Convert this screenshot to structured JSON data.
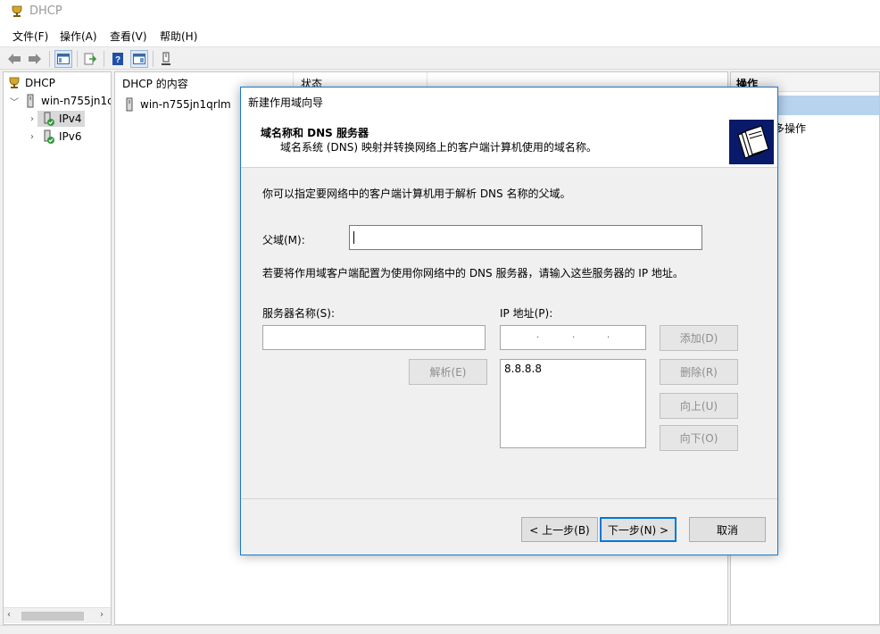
{
  "window": {
    "title": "DHCP"
  },
  "menu": [
    {
      "label": "文件(F)"
    },
    {
      "label": "操作(A)"
    },
    {
      "label": "查看(V)"
    },
    {
      "label": "帮助(H)"
    }
  ],
  "toolbar": {
    "buttons": [
      "back-arrow-icon",
      "forward-arrow-icon",
      "show-hide-console-tree-icon",
      "export-list-icon",
      "help-icon",
      "properties-icon",
      "server-icon"
    ]
  },
  "tree": {
    "root": "DHCP",
    "server": "win-n755jn1c",
    "children": [
      "IPv4",
      "IPv6"
    ]
  },
  "content": {
    "columns": [
      "DHCP 的内容",
      "状态"
    ],
    "rows": [
      {
        "name": "win-n755jn1qrlm"
      }
    ]
  },
  "actions": {
    "title": "操作",
    "more": "多操作"
  },
  "wizard": {
    "title": "新建作用域向导",
    "header_title": "域名称和 DNS 服务器",
    "header_subtitle": "域名系统 (DNS) 映射并转换网络上的客户端计算机使用的域名称。",
    "intro": "你可以指定要网络中的客户端计算机用于解析 DNS 名称的父域。",
    "parent_domain_label": "父域(M):",
    "parent_domain_value": "",
    "dns_intro": "若要将作用域客户端配置为使用你网络中的 DNS 服务器，请输入这些服务器的 IP 地址。",
    "server_name_label": "服务器名称(S):",
    "ip_label": "IP 地址(P):",
    "ip_list": [
      "8.8.8.8"
    ],
    "buttons": {
      "resolve": "解析(E)",
      "add": "添加(D)",
      "remove": "删除(R)",
      "up": "向上(U)",
      "down": "向下(O)",
      "back": "< 上一步(B)",
      "next": "下一步(N) >",
      "cancel": "取消"
    }
  },
  "colors": {
    "accent": "#0078d7",
    "dialog_border": "#1979ca",
    "selection": "#b8d3ee",
    "header_image_bg": "#0a1a6a"
  }
}
